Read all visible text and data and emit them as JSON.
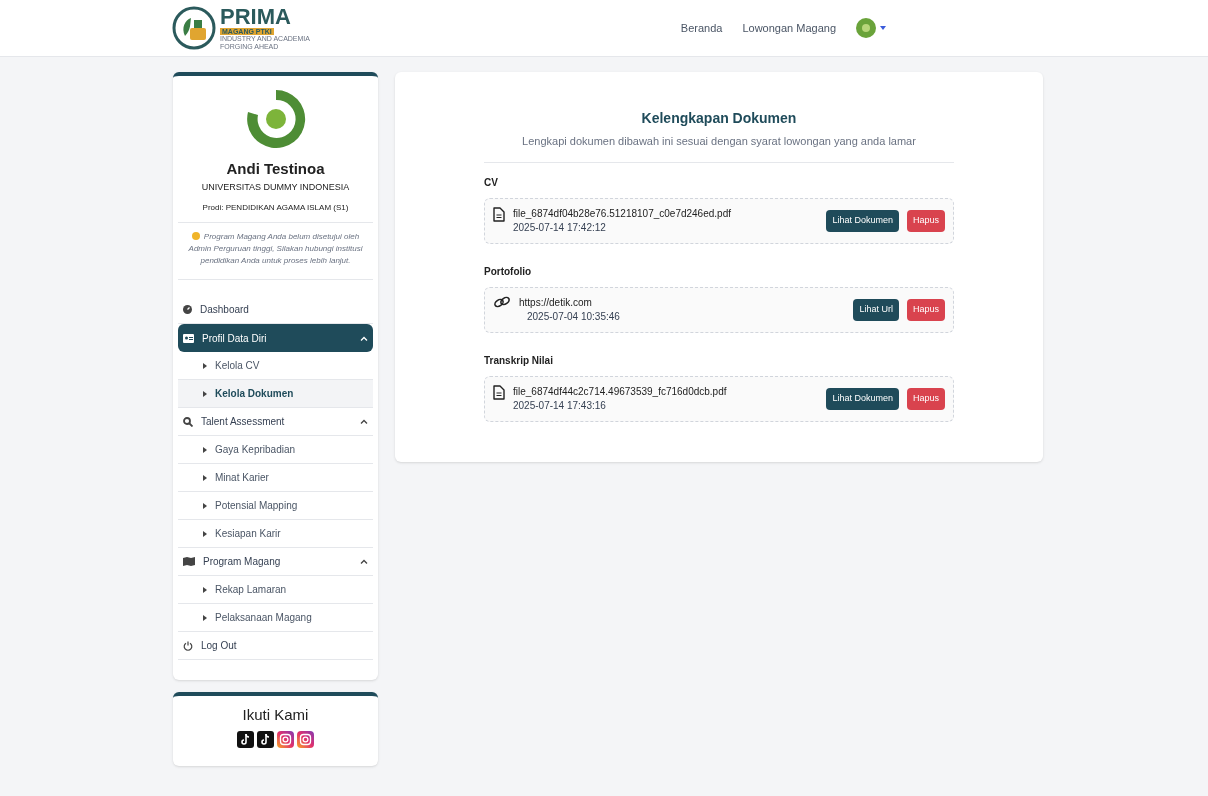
{
  "header": {
    "logo": {
      "title": "PRIMA",
      "subtitle": "MAGANG PTKI",
      "tagline": [
        "INDUSTRY AND ACADEMIA",
        "FORGING AHEAD"
      ]
    },
    "nav": [
      {
        "label": "Beranda"
      },
      {
        "label": "Lowongan Magang"
      }
    ]
  },
  "profile": {
    "name": "Andi Testinoa",
    "university": "UNIVERSITAS DUMMY INDONESIA",
    "prodi": "Prodi: PENDIDIKAN AGAMA ISLAM (S1)",
    "notice": "Program Magang Anda belum disetujui oleh Admin Perguruan tinggi, Silakan hubungi institusi pendidikan Anda untuk proses lebih lanjut."
  },
  "sidebar": {
    "items": [
      {
        "label": "Dashboard",
        "selected": false
      },
      {
        "label": "Profil Data Diri",
        "selected": true,
        "expanded": true,
        "children": [
          {
            "label": "Kelola CV",
            "selected": false
          },
          {
            "label": "Kelola Dokumen",
            "selected": true
          }
        ]
      },
      {
        "label": "Talent Assessment",
        "selected": false,
        "expanded": true,
        "children": [
          {
            "label": "Gaya Kepribadian",
            "selected": false
          },
          {
            "label": "Minat Karier",
            "selected": false
          },
          {
            "label": "Potensial Mapping",
            "selected": false
          },
          {
            "label": "Kesiapan Karir",
            "selected": false
          }
        ]
      },
      {
        "label": "Program Magang",
        "selected": false,
        "expanded": true,
        "children": [
          {
            "label": "Rekap Lamaran",
            "selected": false
          },
          {
            "label": "Pelaksanaan Magang",
            "selected": false
          }
        ]
      },
      {
        "label": "Log Out",
        "selected": false
      }
    ]
  },
  "social": {
    "title": "Ikuti Kami",
    "links": [
      {
        "kind": "tiktok"
      },
      {
        "kind": "tiktok"
      },
      {
        "kind": "instagram"
      },
      {
        "kind": "instagram"
      }
    ]
  },
  "main": {
    "title": "Kelengkapan Dokumen",
    "subtitle": "Lengkapi dokumen dibawah ini sesuai dengan syarat lowongan yang anda lamar",
    "documents": [
      {
        "label": "CV",
        "kind": "file",
        "name": "file_6874df04b28e76.51218107_c0e7d246ed.pdf",
        "date": "2025-07-14 17:42:12",
        "view": "Lihat Dokumen",
        "delete": "Hapus"
      },
      {
        "label": "Portofolio",
        "kind": "link",
        "name": "https://detik.com",
        "date": "2025-07-04 10:35:46",
        "view": "Lihat Url",
        "delete": "Hapus"
      },
      {
        "label": "Transkrip Nilai",
        "kind": "file",
        "name": "file_6874df44c2c714.49673539_fc716d0dcb.pdf",
        "date": "2025-07-14 17:43:16",
        "view": "Lihat Dokumen",
        "delete": "Hapus"
      }
    ]
  }
}
